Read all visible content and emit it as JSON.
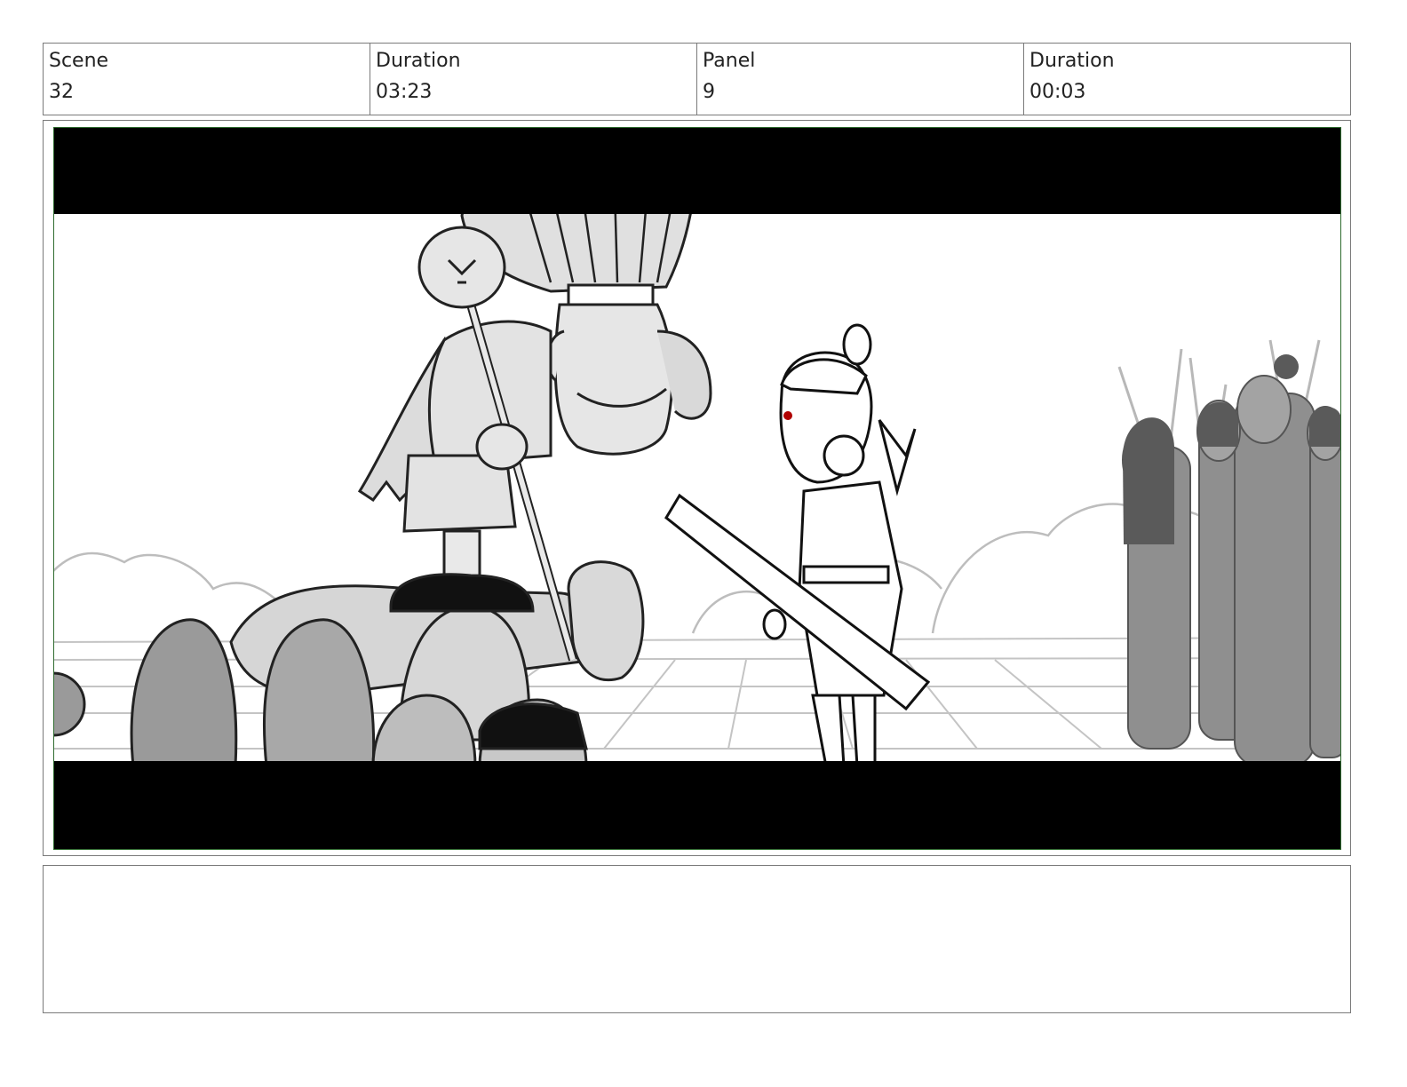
{
  "header": {
    "scene_label": "Scene",
    "scene_value": "32",
    "scene_duration_label": "Duration",
    "scene_duration_value": "03:23",
    "panel_label": "Panel",
    "panel_value": "9",
    "panel_duration_label": "Duration",
    "panel_duration_value": "00:03"
  },
  "panel": {
    "letterbox_color": "#000000",
    "safe_frame_color": "#2f6b2f"
  },
  "notes": {
    "text": ""
  }
}
